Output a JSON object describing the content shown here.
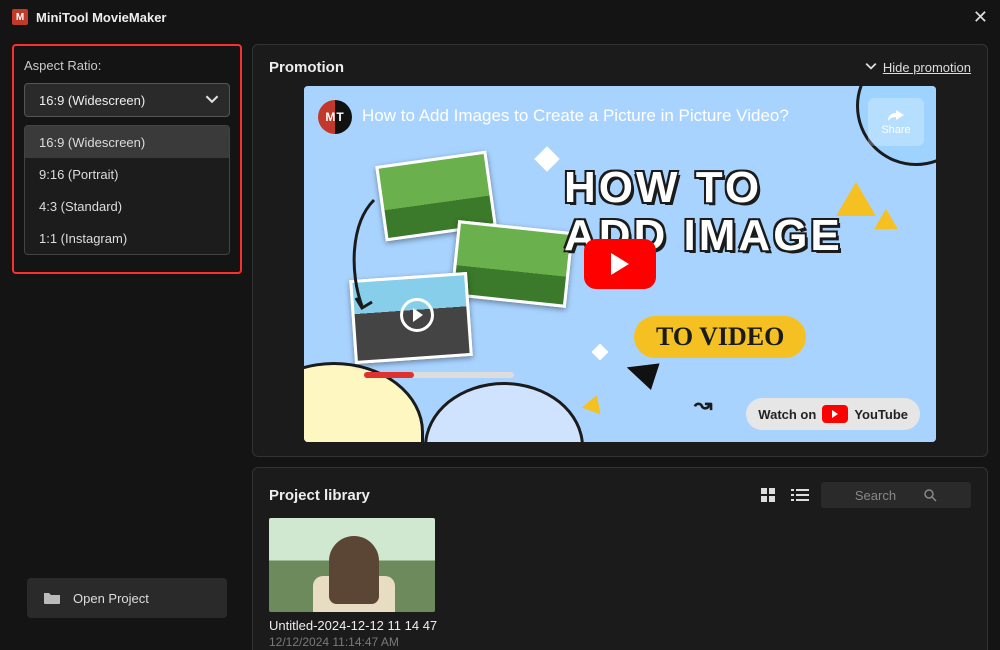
{
  "app": {
    "title": "MiniTool MovieMaker"
  },
  "aspect": {
    "label": "Aspect Ratio:",
    "selected": "16:9 (Widescreen)",
    "options": [
      "16:9 (Widescreen)",
      "9:16 (Portrait)",
      "4:3 (Standard)",
      "1:1 (Instagram)"
    ]
  },
  "open_project_label": "Open Project",
  "promotion": {
    "section_title": "Promotion",
    "hide_label": "Hide promotion",
    "video_title": "How to Add Images to Create a Picture in Picture Video?",
    "share_label": "Share",
    "headline_line1": "HOW TO",
    "headline_line2": "ADD IMAGE",
    "pill_text": "TO VIDEO",
    "watch_on": "Watch on",
    "youtube": "YouTube",
    "mt_logo": "MT"
  },
  "library": {
    "section_title": "Project library",
    "search_placeholder": "Search",
    "projects": [
      {
        "name": "Untitled-2024-12-12 11 14 47",
        "date": "12/12/2024 11:14:47 AM"
      }
    ]
  }
}
